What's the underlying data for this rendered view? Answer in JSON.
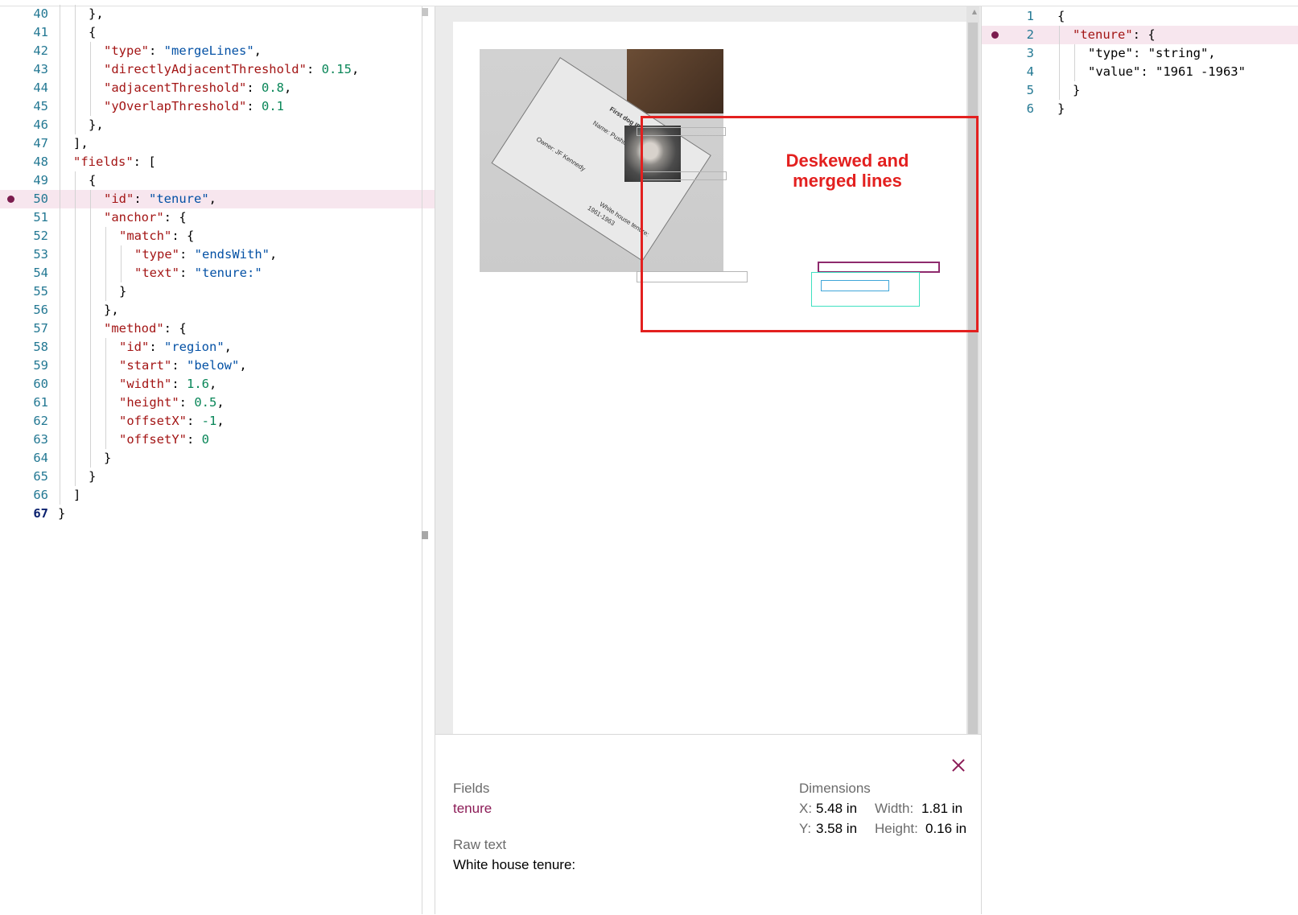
{
  "editor": {
    "lines": [
      {
        "n": "40",
        "indent": 2,
        "parts": [
          [
            "p",
            "},"
          ]
        ]
      },
      {
        "n": "41",
        "indent": 2,
        "parts": [
          [
            "p",
            "{"
          ]
        ]
      },
      {
        "n": "42",
        "indent": 3,
        "parts": [
          [
            "k",
            "\"type\""
          ],
          [
            "p",
            ": "
          ],
          [
            "s",
            "\"mergeLines\""
          ],
          [
            "p",
            ","
          ]
        ]
      },
      {
        "n": "43",
        "indent": 3,
        "parts": [
          [
            "k",
            "\"directlyAdjacentThreshold\""
          ],
          [
            "p",
            ": "
          ],
          [
            "n",
            "0.15"
          ],
          [
            "p",
            ","
          ]
        ]
      },
      {
        "n": "44",
        "indent": 3,
        "parts": [
          [
            "k",
            "\"adjacentThreshold\""
          ],
          [
            "p",
            ": "
          ],
          [
            "n",
            "0.8"
          ],
          [
            "p",
            ","
          ]
        ]
      },
      {
        "n": "45",
        "indent": 3,
        "parts": [
          [
            "k",
            "\"yOverlapThreshold\""
          ],
          [
            "p",
            ": "
          ],
          [
            "n",
            "0.1"
          ]
        ]
      },
      {
        "n": "46",
        "indent": 2,
        "parts": [
          [
            "p",
            "},"
          ]
        ]
      },
      {
        "n": "47",
        "indent": 1,
        "parts": [
          [
            "p",
            "],"
          ]
        ]
      },
      {
        "n": "48",
        "indent": 1,
        "parts": [
          [
            "k",
            "\"fields\""
          ],
          [
            "p",
            ": ["
          ]
        ]
      },
      {
        "n": "49",
        "indent": 2,
        "parts": [
          [
            "p",
            "{"
          ]
        ]
      },
      {
        "n": "50",
        "indent": 3,
        "parts": [
          [
            "k",
            "\"id\""
          ],
          [
            "p",
            ": "
          ],
          [
            "s",
            "\"tenure\""
          ],
          [
            "p",
            ","
          ]
        ],
        "highlight": true
      },
      {
        "n": "51",
        "indent": 3,
        "parts": [
          [
            "k",
            "\"anchor\""
          ],
          [
            "p",
            ": {"
          ]
        ]
      },
      {
        "n": "52",
        "indent": 4,
        "parts": [
          [
            "k",
            "\"match\""
          ],
          [
            "p",
            ": {"
          ]
        ]
      },
      {
        "n": "53",
        "indent": 5,
        "parts": [
          [
            "k",
            "\"type\""
          ],
          [
            "p",
            ": "
          ],
          [
            "s",
            "\"endsWith\""
          ],
          [
            "p",
            ","
          ]
        ]
      },
      {
        "n": "54",
        "indent": 5,
        "parts": [
          [
            "k",
            "\"text\""
          ],
          [
            "p",
            ": "
          ],
          [
            "s",
            "\"tenure:\""
          ]
        ]
      },
      {
        "n": "55",
        "indent": 4,
        "parts": [
          [
            "p",
            "}"
          ]
        ]
      },
      {
        "n": "56",
        "indent": 3,
        "parts": [
          [
            "p",
            "},"
          ]
        ]
      },
      {
        "n": "57",
        "indent": 3,
        "parts": [
          [
            "k",
            "\"method\""
          ],
          [
            "p",
            ": {"
          ]
        ]
      },
      {
        "n": "58",
        "indent": 4,
        "parts": [
          [
            "k",
            "\"id\""
          ],
          [
            "p",
            ": "
          ],
          [
            "s",
            "\"region\""
          ],
          [
            "p",
            ","
          ]
        ]
      },
      {
        "n": "59",
        "indent": 4,
        "parts": [
          [
            "k",
            "\"start\""
          ],
          [
            "p",
            ": "
          ],
          [
            "s",
            "\"below\""
          ],
          [
            "p",
            ","
          ]
        ]
      },
      {
        "n": "60",
        "indent": 4,
        "parts": [
          [
            "k",
            "\"width\""
          ],
          [
            "p",
            ": "
          ],
          [
            "n",
            "1.6"
          ],
          [
            "p",
            ","
          ]
        ]
      },
      {
        "n": "61",
        "indent": 4,
        "parts": [
          [
            "k",
            "\"height\""
          ],
          [
            "p",
            ": "
          ],
          [
            "n",
            "0.5"
          ],
          [
            "p",
            ","
          ]
        ]
      },
      {
        "n": "62",
        "indent": 4,
        "parts": [
          [
            "k",
            "\"offsetX\""
          ],
          [
            "p",
            ": "
          ],
          [
            "n",
            "-1"
          ],
          [
            "p",
            ","
          ]
        ]
      },
      {
        "n": "63",
        "indent": 4,
        "parts": [
          [
            "k",
            "\"offsetY\""
          ],
          [
            "p",
            ": "
          ],
          [
            "n",
            "0"
          ]
        ]
      },
      {
        "n": "64",
        "indent": 3,
        "parts": [
          [
            "p",
            "}"
          ]
        ]
      },
      {
        "n": "65",
        "indent": 2,
        "parts": [
          [
            "p",
            "}"
          ]
        ]
      },
      {
        "n": "66",
        "indent": 1,
        "parts": [
          [
            "p",
            "]"
          ]
        ]
      },
      {
        "n": "67",
        "indent": 0,
        "parts": [
          [
            "p",
            "}"
          ]
        ],
        "active": true
      }
    ]
  },
  "preview": {
    "annotation_line1": "Deskewed and",
    "annotation_line2": "merged lines",
    "card_title": "First dog ID card",
    "card_name": "Name: Pushinka",
    "card_owner": "Owner: JF Kennedy",
    "card_tenure": "White house tenure:",
    "card_years": "1961-1963",
    "box_colors": {
      "gray": "#b5b5b5",
      "purple": "#8e2a6d",
      "blue": "#3fa6d9",
      "teal": "#3fe0c0",
      "red": "#e3201f"
    }
  },
  "details": {
    "fields_label": "Fields",
    "field_name": "tenure",
    "dimensions_label": "Dimensions",
    "x_label": "X:",
    "x_value": "5.48 in",
    "y_label": "Y:",
    "y_value": "3.58 in",
    "width_label": "Width:",
    "width_value": "1.81 in",
    "height_label": "Height:",
    "height_value": "0.16 in",
    "raw_text_label": "Raw text",
    "raw_text_value": "White house tenure:"
  },
  "output": {
    "lines": [
      {
        "n": "1",
        "indent": 0,
        "parts": [
          [
            "p",
            "{"
          ]
        ]
      },
      {
        "n": "2",
        "indent": 1,
        "parts": [
          [
            "k",
            "\"tenure\""
          ],
          [
            "p",
            ": {"
          ]
        ],
        "highlight": true
      },
      {
        "n": "3",
        "indent": 2,
        "parts": [
          [
            "p",
            "\"type\": \"string\","
          ]
        ]
      },
      {
        "n": "4",
        "indent": 2,
        "parts": [
          [
            "p",
            "\"value\": \"1961 -1963\""
          ]
        ]
      },
      {
        "n": "5",
        "indent": 1,
        "parts": [
          [
            "p",
            "}"
          ]
        ]
      },
      {
        "n": "6",
        "indent": 0,
        "parts": [
          [
            "p",
            "}"
          ]
        ]
      }
    ]
  }
}
